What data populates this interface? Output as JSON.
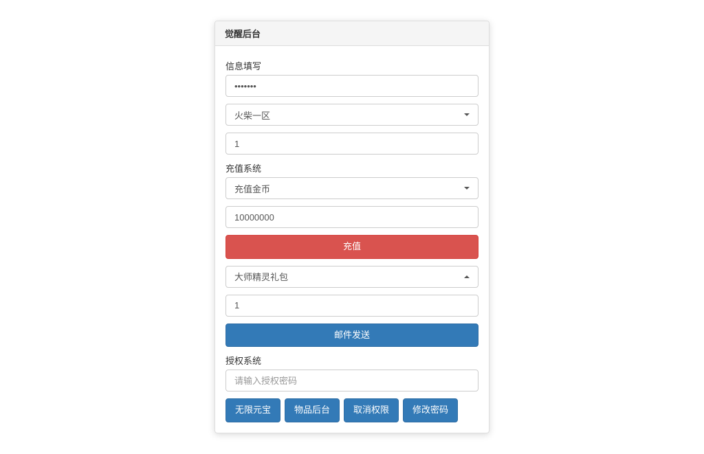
{
  "panel": {
    "title": "觉醒后台",
    "section1_label": "信息填写",
    "password_value": "•••••••",
    "server_select": "火柴一区",
    "id_value": "1",
    "section2_label": "充值系统",
    "recharge_type": "充值金币",
    "amount_value": "10000000",
    "recharge_button": "充值",
    "gift_select": "大师精灵礼包",
    "gift_qty": "1",
    "mail_button": "邮件发送",
    "section3_label": "授权系统",
    "auth_placeholder": "请输入授权密码",
    "buttons": {
      "unlimited": "无限元宝",
      "items": "物品后台",
      "cancel": "取消权限",
      "changepw": "修改密码"
    }
  }
}
